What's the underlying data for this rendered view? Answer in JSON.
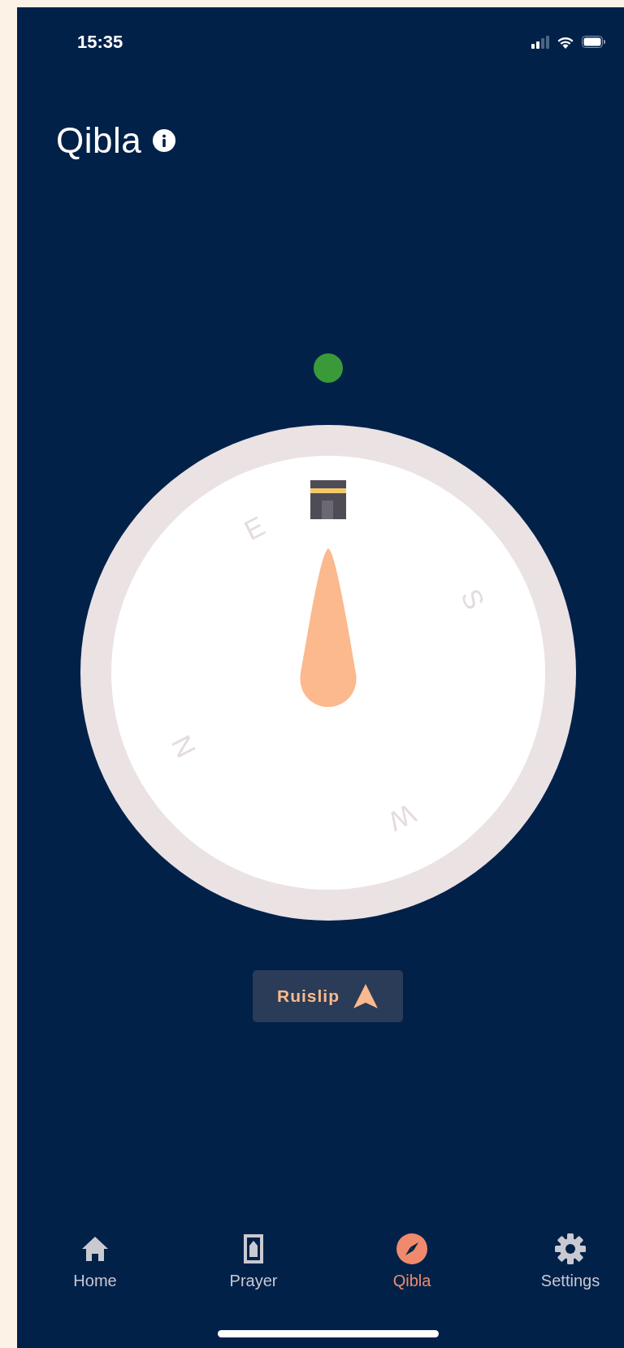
{
  "status_bar": {
    "time": "15:35"
  },
  "header": {
    "title": "Qibla"
  },
  "compass": {
    "aligned": true,
    "directions": [
      {
        "kind": "north",
        "label": "N"
      },
      {
        "kind": "east",
        "label": "E"
      },
      {
        "kind": "south",
        "label": "S"
      },
      {
        "kind": "west",
        "label": "W"
      }
    ]
  },
  "location_button": {
    "label": "Ruislip"
  },
  "tabs": [
    {
      "kind": "home",
      "label": "Home",
      "selected": false
    },
    {
      "kind": "prayer",
      "label": "Prayer",
      "selected": false
    },
    {
      "kind": "qibla",
      "label": "Qibla",
      "selected": true
    },
    {
      "kind": "settings",
      "label": "Settings",
      "selected": false
    }
  ]
}
